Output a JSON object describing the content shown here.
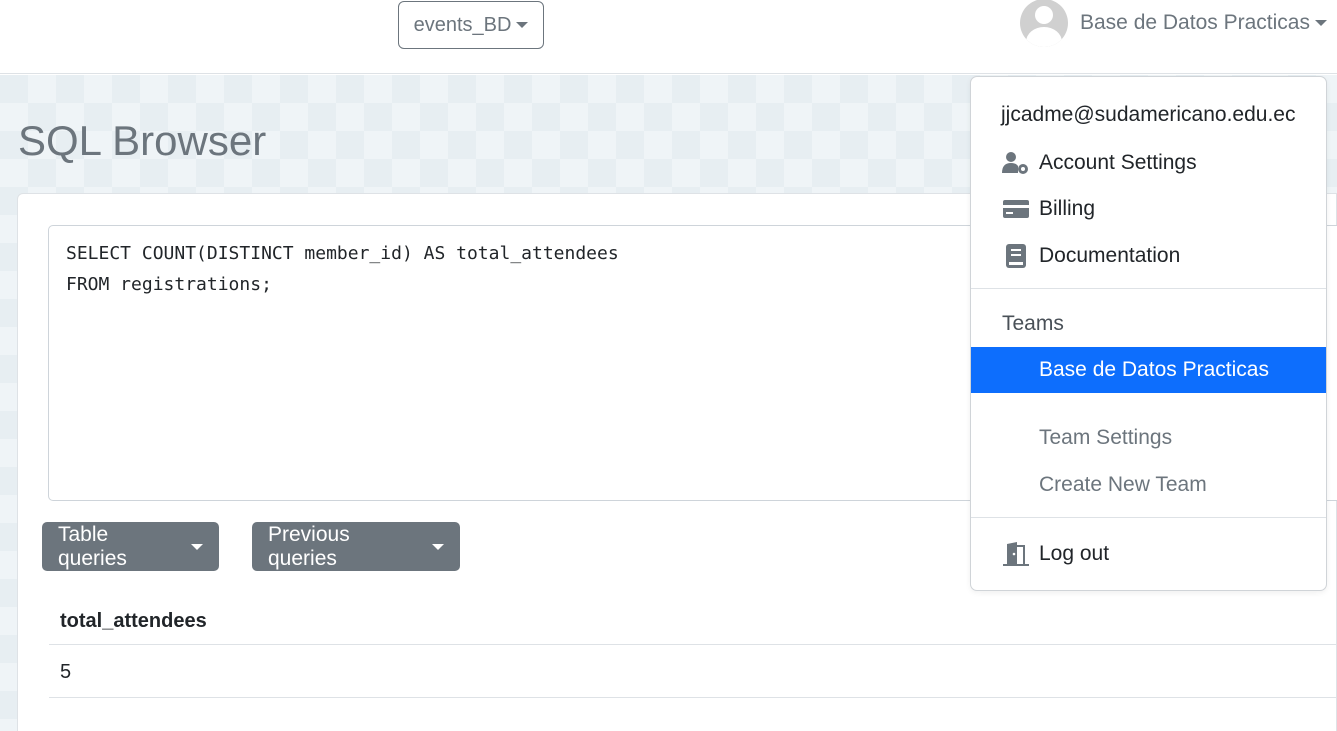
{
  "navbar": {
    "database_selector": "events_BD",
    "user_team_name": "Base de Datos Practicas"
  },
  "page": {
    "title": "SQL Browser"
  },
  "editor": {
    "query": "SELECT COUNT(DISTINCT member_id) AS total_attendees\nFROM registrations;"
  },
  "buttons": {
    "table_queries": "Table queries",
    "previous_queries": "Previous queries"
  },
  "results": {
    "columns": [
      "total_attendees"
    ],
    "rows": [
      [
        "5"
      ]
    ]
  },
  "user_menu": {
    "email": "jjcadme@sudamericano.edu.ec",
    "account_settings": "Account Settings",
    "billing": "Billing",
    "documentation": "Documentation",
    "teams_header": "Teams",
    "current_team": "Base de Datos Practicas",
    "team_settings": "Team Settings",
    "create_new_team": "Create New Team",
    "logout": "Log out"
  },
  "icons": [
    "user-cog-icon",
    "credit-card-icon",
    "book-icon",
    "door-exit-icon",
    "avatar-icon",
    "caret-down-icon"
  ],
  "colors": {
    "primary": "#0d6efd",
    "secondary": "#6c757d"
  }
}
